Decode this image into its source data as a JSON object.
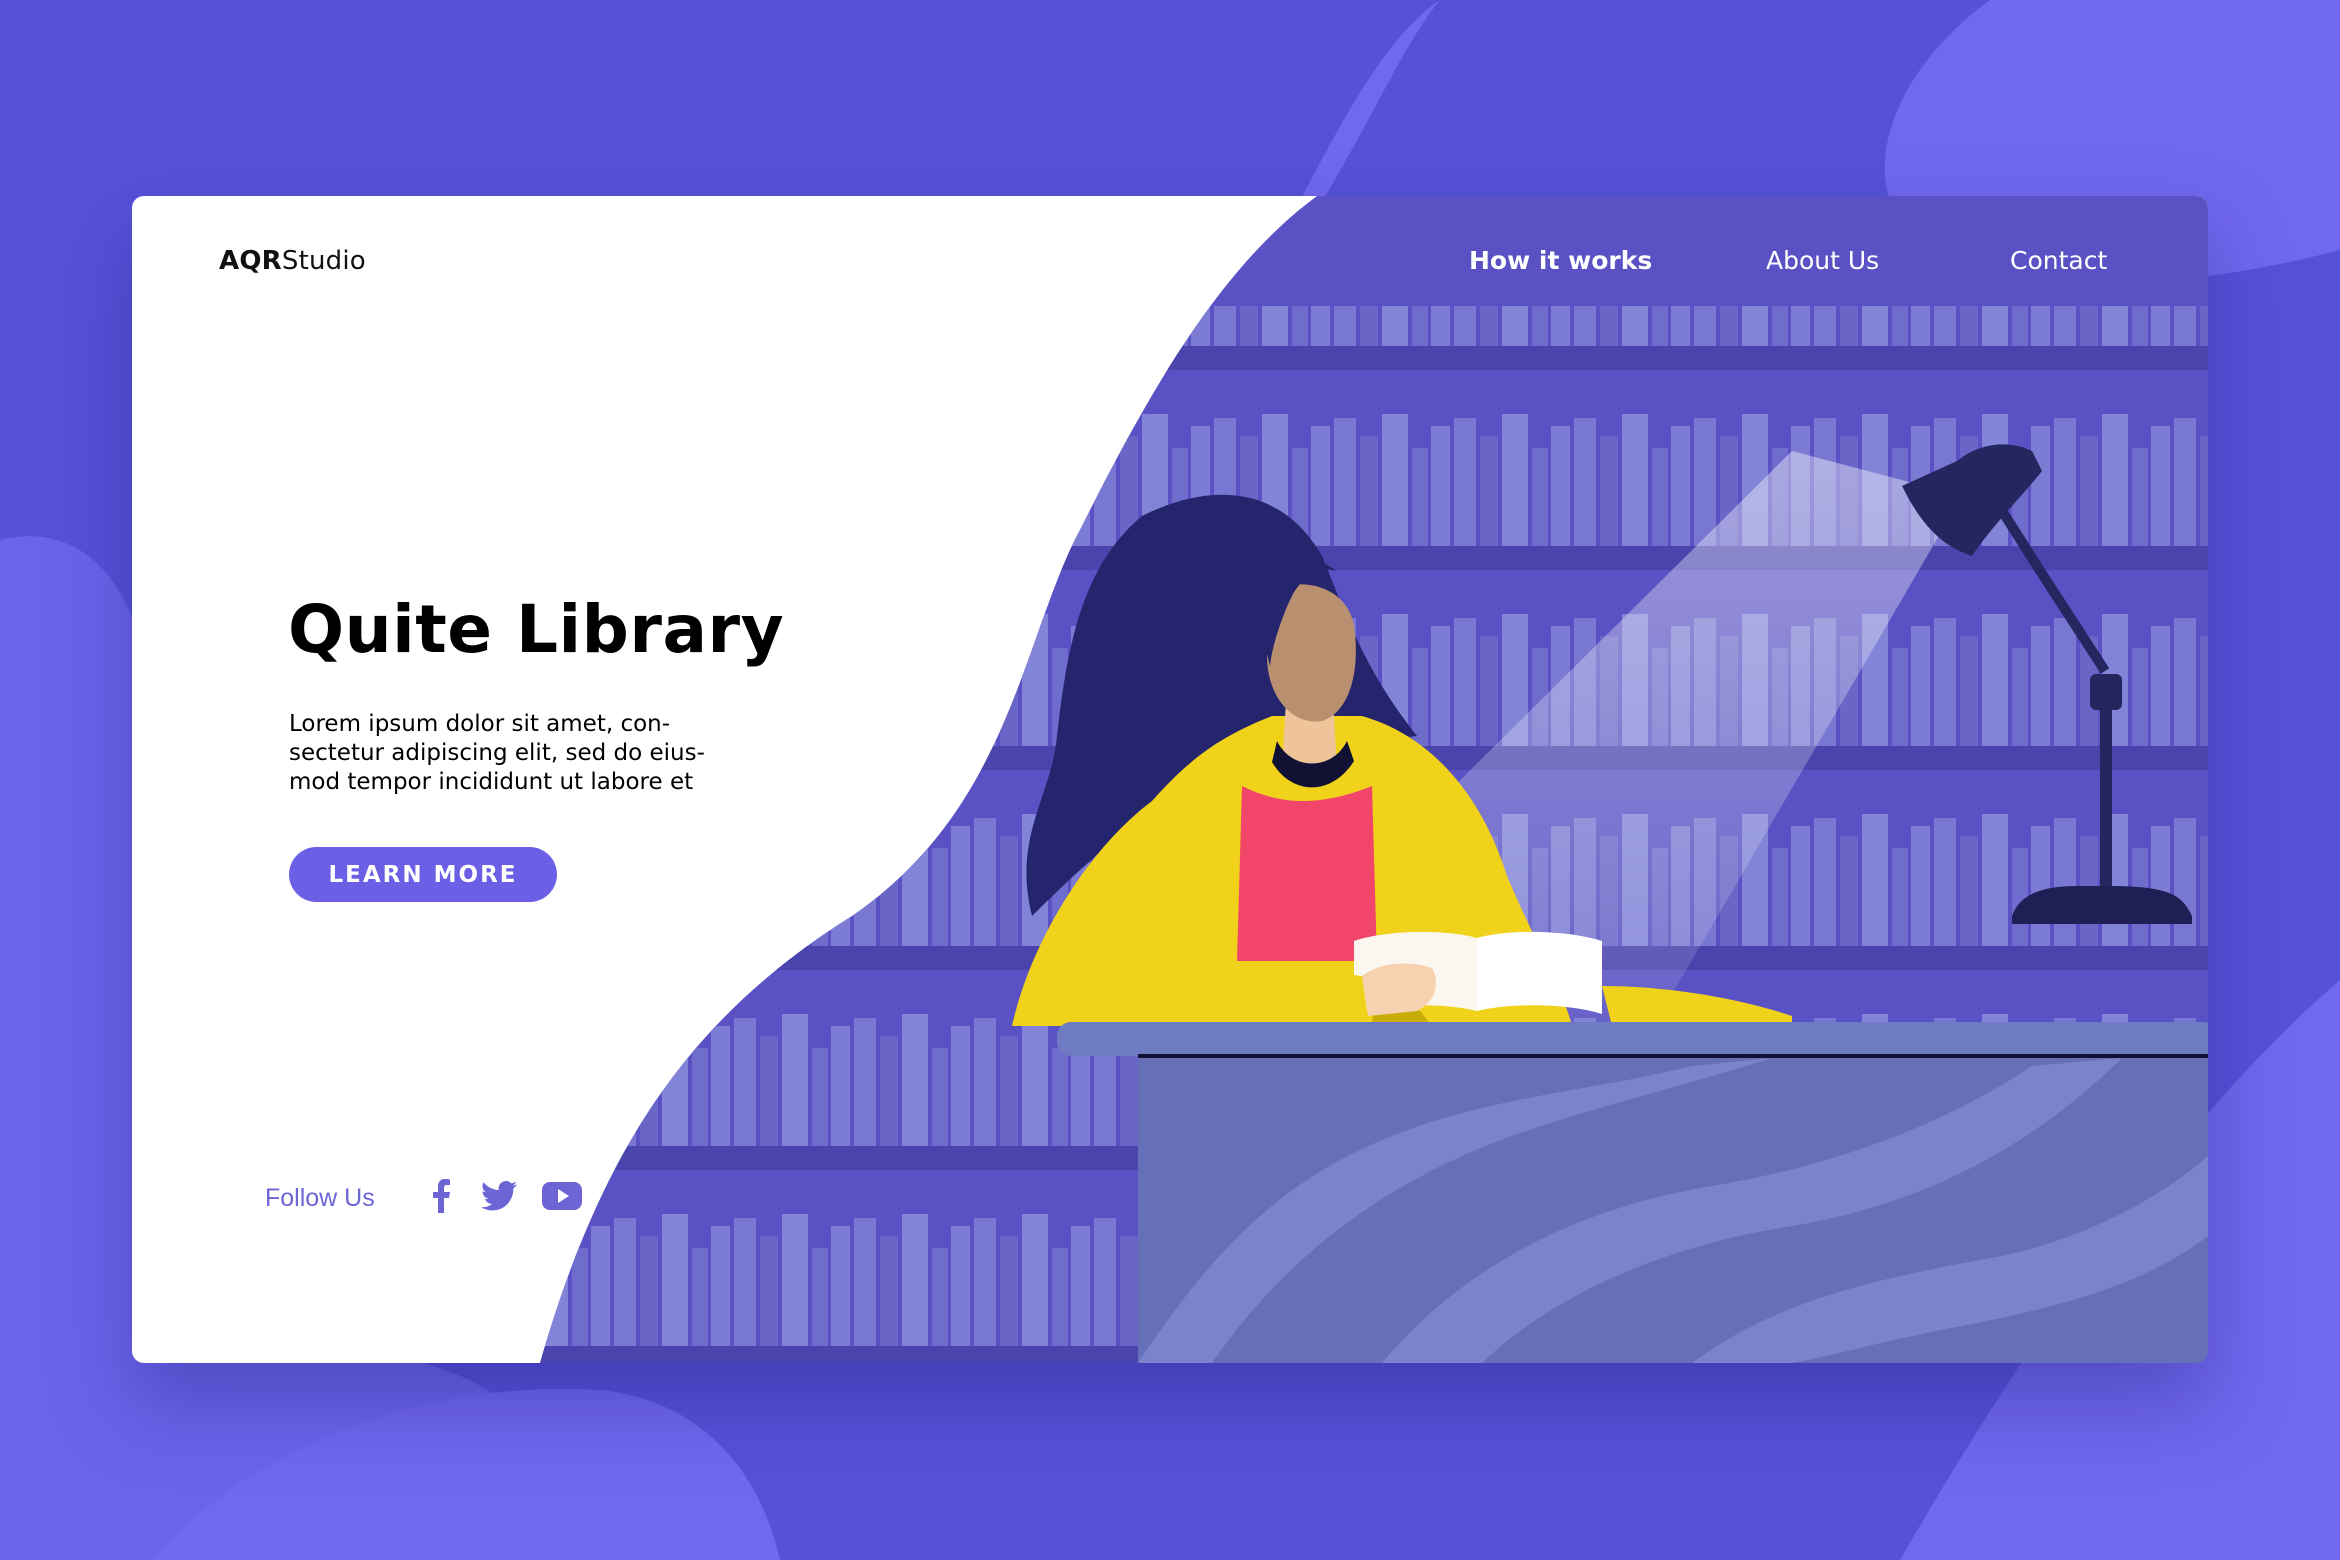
{
  "brand": {
    "bold": "AQR",
    "regular": "Studio"
  },
  "nav": {
    "items": [
      {
        "label": "How it works",
        "active": true
      },
      {
        "label": "About Us",
        "active": false
      },
      {
        "label": "Contact",
        "active": false
      }
    ]
  },
  "hero": {
    "title": "Quite Library",
    "description_lines": [
      "Lorem ipsum dolor sit amet, con-",
      "sectetur adipiscing elit, sed do eius-",
      "mod tempor incididunt ut labore et"
    ],
    "cta_label": "LEARN MORE"
  },
  "footer": {
    "follow_label": "Follow Us",
    "social_icons": [
      "facebook-icon",
      "twitter-icon",
      "youtube-icon"
    ]
  },
  "colors": {
    "page_background": "#5652d8",
    "accent": "#6b5fe6",
    "illustration_background": "#5a52c4",
    "desk": "#6670b8",
    "jacket": "#f1d21a",
    "shirt": "#f2456a",
    "hair": "#25256e"
  }
}
